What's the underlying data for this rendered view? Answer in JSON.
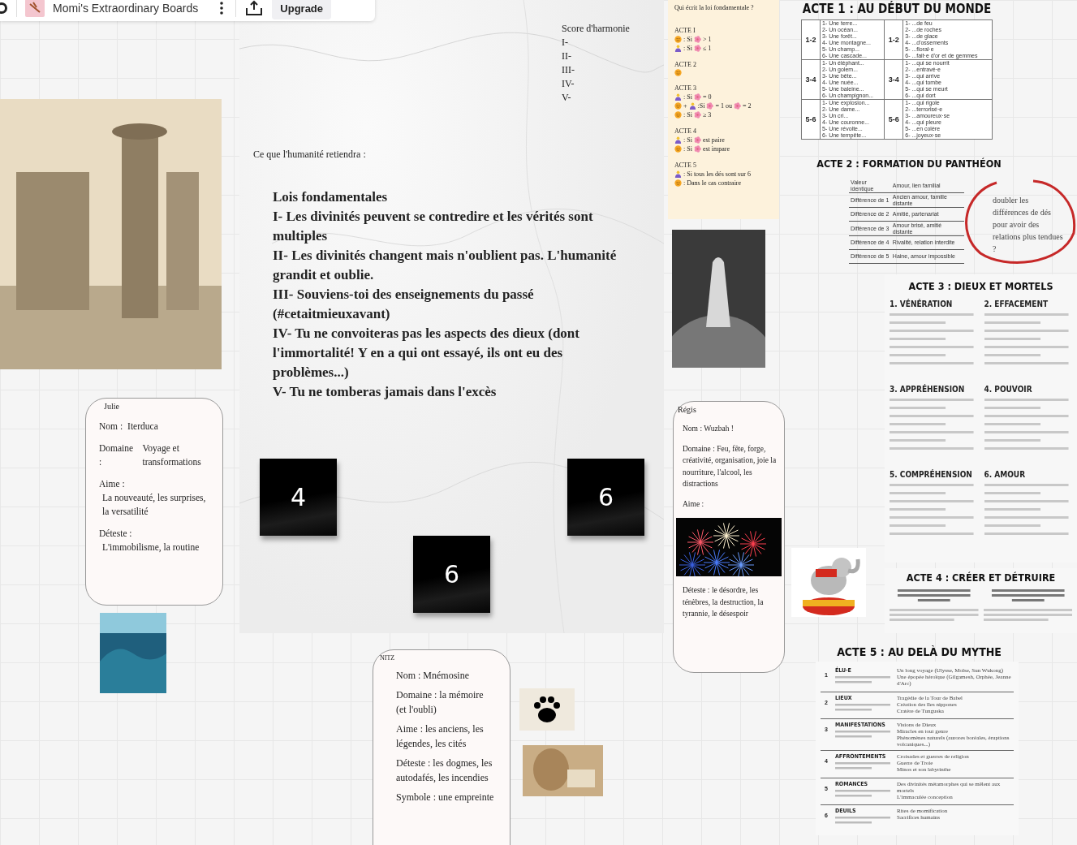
{
  "toolbar": {
    "board_name": "Momi's Extraordinary Boards",
    "upgrade": "Upgrade"
  },
  "law_board": {
    "score_title": "Score d'harmonie",
    "score_lines": [
      "I-",
      "II-",
      "III-",
      "IV-",
      "V-"
    ],
    "caption": "Ce que l'humanité retiendra :",
    "laws_title": "Lois fondamentales",
    "laws": [
      "I- Les divinités peuvent se contredire et les vérités sont multiples",
      "II- Les divinités changent mais n'oublient pas. L'humanité grandit et oublie.",
      "III- Souviens-toi des enseignements du passé (#cetaitmieuxavant)",
      "IV- Tu ne convoiteras pas les aspects des dieux (dont l'immortalité! Y en a qui ont essayé, ils ont eu des problèmes...)",
      "V- Tu ne tomberas jamais dans l'excès"
    ],
    "dice": [
      "4",
      "6",
      "6"
    ]
  },
  "rules_note": {
    "title": "Qui écrit la loi fondamentale ?",
    "acts": [
      {
        "label": "ACTE I",
        "lines": [
          [
            {
              "kind": "smiley"
            },
            {
              "kind": "text",
              "text": ": Si"
            },
            {
              "kind": "flower"
            },
            {
              "kind": "text",
              "text": "> 1"
            }
          ],
          [
            {
              "kind": "person"
            },
            {
              "kind": "text",
              "text": ": Si"
            },
            {
              "kind": "flower"
            },
            {
              "kind": "text",
              "text": "≤ 1"
            }
          ]
        ]
      },
      {
        "label": "ACTE 2",
        "lines": [
          [
            {
              "kind": "smiley"
            }
          ]
        ]
      },
      {
        "label": "ACTE 3",
        "lines": [
          [
            {
              "kind": "person"
            },
            {
              "kind": "text",
              "text": ": Si"
            },
            {
              "kind": "flower"
            },
            {
              "kind": "text",
              "text": "= 0"
            }
          ],
          [
            {
              "kind": "smiley"
            },
            {
              "kind": "text",
              "text": "+"
            },
            {
              "kind": "person"
            },
            {
              "kind": "text",
              "text": ":Si"
            },
            {
              "kind": "flower"
            },
            {
              "kind": "text",
              "text": "= 1 ou"
            },
            {
              "kind": "flower"
            },
            {
              "kind": "text",
              "text": "= 2"
            }
          ],
          [
            {
              "kind": "smiley"
            },
            {
              "kind": "text",
              "text": ": Si"
            },
            {
              "kind": "flower"
            },
            {
              "kind": "text",
              "text": "≥ 3"
            }
          ]
        ]
      },
      {
        "label": "ACTE 4",
        "lines": [
          [
            {
              "kind": "person"
            },
            {
              "kind": "text",
              "text": ": Si"
            },
            {
              "kind": "flower"
            },
            {
              "kind": "text",
              "text": "est paire"
            }
          ],
          [
            {
              "kind": "smiley"
            },
            {
              "kind": "text",
              "text": ": Si"
            },
            {
              "kind": "flower"
            },
            {
              "kind": "text",
              "text": "est impare"
            }
          ]
        ]
      },
      {
        "label": "ACTE 5",
        "lines": [
          [
            {
              "kind": "person"
            },
            {
              "kind": "text",
              "text": ": Si tous les dés sont sur 6"
            }
          ],
          [
            {
              "kind": "smiley"
            },
            {
              "kind": "text",
              "text": ": Dans le cas contraire"
            }
          ]
        ]
      }
    ]
  },
  "act1": {
    "title": "ACTE 1 : AU DÉBUT DU MONDE",
    "groups": [
      {
        "roll_left": "1-2",
        "left": [
          "1- Une terre...",
          "2- Un océan...",
          "3- Une forêt...",
          "4- Une montagne...",
          "5- Un champ...",
          "6- Une cascade..."
        ],
        "roll_right": "1-2",
        "right": [
          "1- ...de feu",
          "2- ...de roches",
          "3- ...de glace",
          "4- ...d'ossements",
          "5- ...floral·e",
          "6- ...fait·e d'or et de gemmes"
        ]
      },
      {
        "roll_left": "3-4",
        "left": [
          "1- Un éléphant...",
          "2- Un golem...",
          "3- Une bête...",
          "4- Une nuée...",
          "5- Une baleine...",
          "6- Un champignon..."
        ],
        "roll_right": "3-4",
        "right": [
          "1- ...qui se nourrit",
          "2- ...entravé·e",
          "3- ...qui arrive",
          "4- ...qui tombe",
          "5- ...qui se meurt",
          "6- ...qui dort"
        ]
      },
      {
        "roll_left": "5-6",
        "left": [
          "1- Une explosion...",
          "2- Une dame...",
          "3- Un cri...",
          "4- Une couronne...",
          "5- Une révolte...",
          "6- Une tempête..."
        ],
        "roll_right": "5-6",
        "right": [
          "1- ...qui rigole",
          "2- ...terrorisé·e",
          "3- ...amoureux·se",
          "4- ...qui pleure",
          "5- ...en colère",
          "6- ...joyeux·se"
        ]
      }
    ]
  },
  "act2": {
    "title": "ACTE 2 : FORMATION DU PANTHÉON",
    "rows": [
      {
        "difference": "Valeur identique",
        "relation": "Amour, lien familial"
      },
      {
        "difference": "Différence de 1",
        "relation": "Ancien amour, famille distante"
      },
      {
        "difference": "Différence de 2",
        "relation": "Amitié, partenariat"
      },
      {
        "difference": "Différence de 3",
        "relation": "Amour brisé, amitié distante"
      },
      {
        "difference": "Différence de 4",
        "relation": "Rivalité, relation interdite"
      },
      {
        "difference": "Différence de 5",
        "relation": "Haine, amour impossible"
      }
    ]
  },
  "annotation": {
    "text": "doubler les différences de dés pour avoir des relations plus tendues ?"
  },
  "act3": {
    "title": "ACTE 3 : DIEUX ET MORTELS",
    "sections": [
      {
        "title": "1. VÉNÉRATION"
      },
      {
        "title": "2. EFFACEMENT"
      },
      {
        "title": "3. APPRÉHENSION"
      },
      {
        "title": "4. POUVOIR"
      },
      {
        "title": "5. COMPRÉHENSION"
      },
      {
        "title": "6. AMOUR"
      }
    ]
  },
  "act4": {
    "title": "ACTE 4 : CRÉER ET DÉTRUIRE"
  },
  "act5": {
    "title": "ACTE 5 : AU DELÀ DU MYTHE",
    "rows": [
      {
        "number": "1",
        "name": "ÉLU·E",
        "examples": [
          "Un long voyage (Ulysse, Moïse, Sun Wukong)",
          "Une épopée héroïque (Gilgamesh, Orphée, Jeanne d'Arc)"
        ]
      },
      {
        "number": "2",
        "name": "LIEUX",
        "examples": [
          "Tragédie de la Tour de Babel",
          "Création des îles nippones",
          "Cratère de Tunguska"
        ]
      },
      {
        "number": "3",
        "name": "MANIFESTATIONS",
        "examples": [
          "Visions de Dieux",
          "Miracles en tout genre",
          "Phénomènes naturels (aurores boréales, éruptions volcaniques...)"
        ]
      },
      {
        "number": "4",
        "name": "AFFRONTEMENTS",
        "examples": [
          "Croisades et guerres de religion",
          "Guerre de Troie",
          "Minos et son labyrinthe"
        ]
      },
      {
        "number": "5",
        "name": "ROMANCES",
        "examples": [
          "Des divinités métamorphes qui se mêlent aux mortels",
          "L'immaculée conception"
        ]
      },
      {
        "number": "6",
        "name": "DEUILS",
        "examples": [
          "Rites de momification",
          "Sacrifices humains"
        ]
      }
    ]
  },
  "cards": [
    {
      "author": "Julie",
      "entries": [
        {
          "kind": "pair",
          "label": "Nom :",
          "value": "Iterduca"
        },
        {
          "kind": "pair",
          "label": "Domaine :",
          "value": "Voyage et transformations"
        },
        {
          "kind": "stacked",
          "label": "Aime :",
          "value": "La nouveauté, les surprises, la versatilité"
        },
        {
          "kind": "stacked",
          "label": "Déteste :",
          "value": "L'immobilisme, la routine"
        }
      ]
    },
    {
      "author": "Régis",
      "entries": [
        {
          "kind": "line",
          "text": "Nom : Wuzbah !"
        },
        {
          "kind": "line",
          "text": "Domaine : Feu, fête, forge, créativité, organisation, joie la nourriture, l'alcool, les distractions"
        },
        {
          "kind": "line",
          "text": "Aime :"
        },
        {
          "kind": "photo"
        },
        {
          "kind": "line",
          "text": "Déteste : le désordre, les ténèbres, la destruction, la tyrannie, le désespoir"
        }
      ]
    },
    {
      "author": "NITZ",
      "entries": [
        {
          "kind": "line",
          "text": "Nom : Mnémosine"
        },
        {
          "kind": "line",
          "text": "Domaine : la mémoire (et l'oubli)"
        },
        {
          "kind": "line",
          "text": "Aime : les anciens, les légendes, les cités"
        },
        {
          "kind": "line",
          "text": "Déteste : les dogmes, les autodafés, les incendies"
        },
        {
          "kind": "line",
          "text": "Symbole : une empreinte"
        }
      ]
    }
  ]
}
